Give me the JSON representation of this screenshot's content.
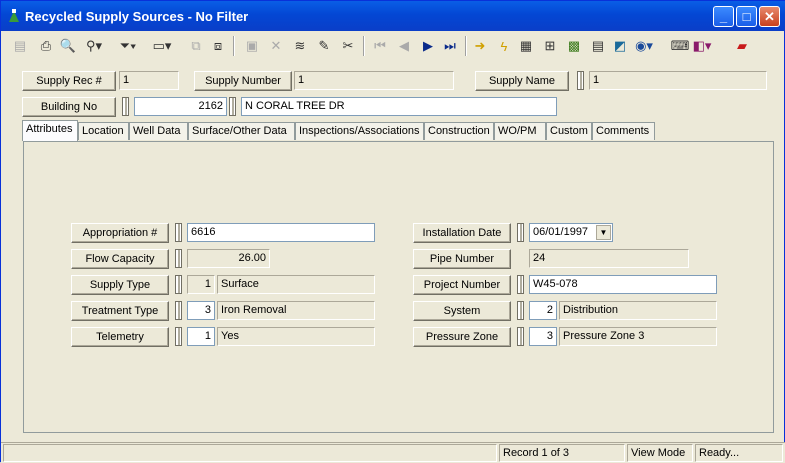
{
  "window": {
    "title": "Recycled Supply Sources - No Filter",
    "minimize": "_",
    "maximize": "□",
    "close": "✕"
  },
  "toolbar": {
    "icons": [
      "new-record-icon",
      "print-icon",
      "print-preview-icon",
      "binoculars-icon",
      "filter-icon",
      "form-view-icon",
      "copy-icon",
      "clone-icon",
      "save-icon",
      "delete-icon",
      "stack-icon",
      "edit-pencil-icon",
      "cut-icon",
      "first-record-icon",
      "previous-record-icon",
      "next-record-icon",
      "last-record-icon",
      "arrow-right-icon",
      "lightning-icon",
      "layers-icon",
      "hierarchy-icon",
      "map-icon",
      "calculator-icon",
      "globe-map-icon",
      "globe-icon",
      "keyboard-icon",
      "book-icon",
      "report-icon"
    ]
  },
  "header": {
    "supply_rec_label": "Supply Rec #",
    "supply_rec_value": "1",
    "supply_number_label": "Supply Number",
    "supply_number_value": "1",
    "supply_name_label": "Supply Name",
    "supply_name_value": "1",
    "building_no_label": "Building No",
    "building_no_value": "2162",
    "building_street": "N CORAL TREE DR"
  },
  "tabs": [
    "Attributes",
    "Location",
    "Well Data",
    "Surface/Other Data",
    "Inspections/Associations",
    "Construction",
    "WO/PM",
    "Custom",
    "Comments"
  ],
  "attributes": {
    "appropriation_label": "Appropriation #",
    "appropriation_value": "6616",
    "flow_capacity_label": "Flow Capacity",
    "flow_capacity_value": "26.00",
    "supply_type_label": "Supply Type",
    "supply_type_code": "1",
    "supply_type_desc": "Surface",
    "treatment_type_label": "Treatment Type",
    "treatment_type_code": "3",
    "treatment_type_desc": "Iron Removal",
    "telemetry_label": "Telemetry",
    "telemetry_code": "1",
    "telemetry_desc": "Yes",
    "installation_date_label": "Installation Date",
    "installation_date_value": "06/01/1997",
    "pipe_number_label": "Pipe Number",
    "pipe_number_value": "24",
    "project_number_label": "Project Number",
    "project_number_value": "W45-078",
    "system_label": "System",
    "system_code": "2",
    "system_desc": "Distribution",
    "pressure_zone_label": "Pressure Zone",
    "pressure_zone_code": "3",
    "pressure_zone_desc": "Pressure Zone 3"
  },
  "status": {
    "record": "Record 1 of 3",
    "mode": "View Mode",
    "state": "Ready..."
  }
}
